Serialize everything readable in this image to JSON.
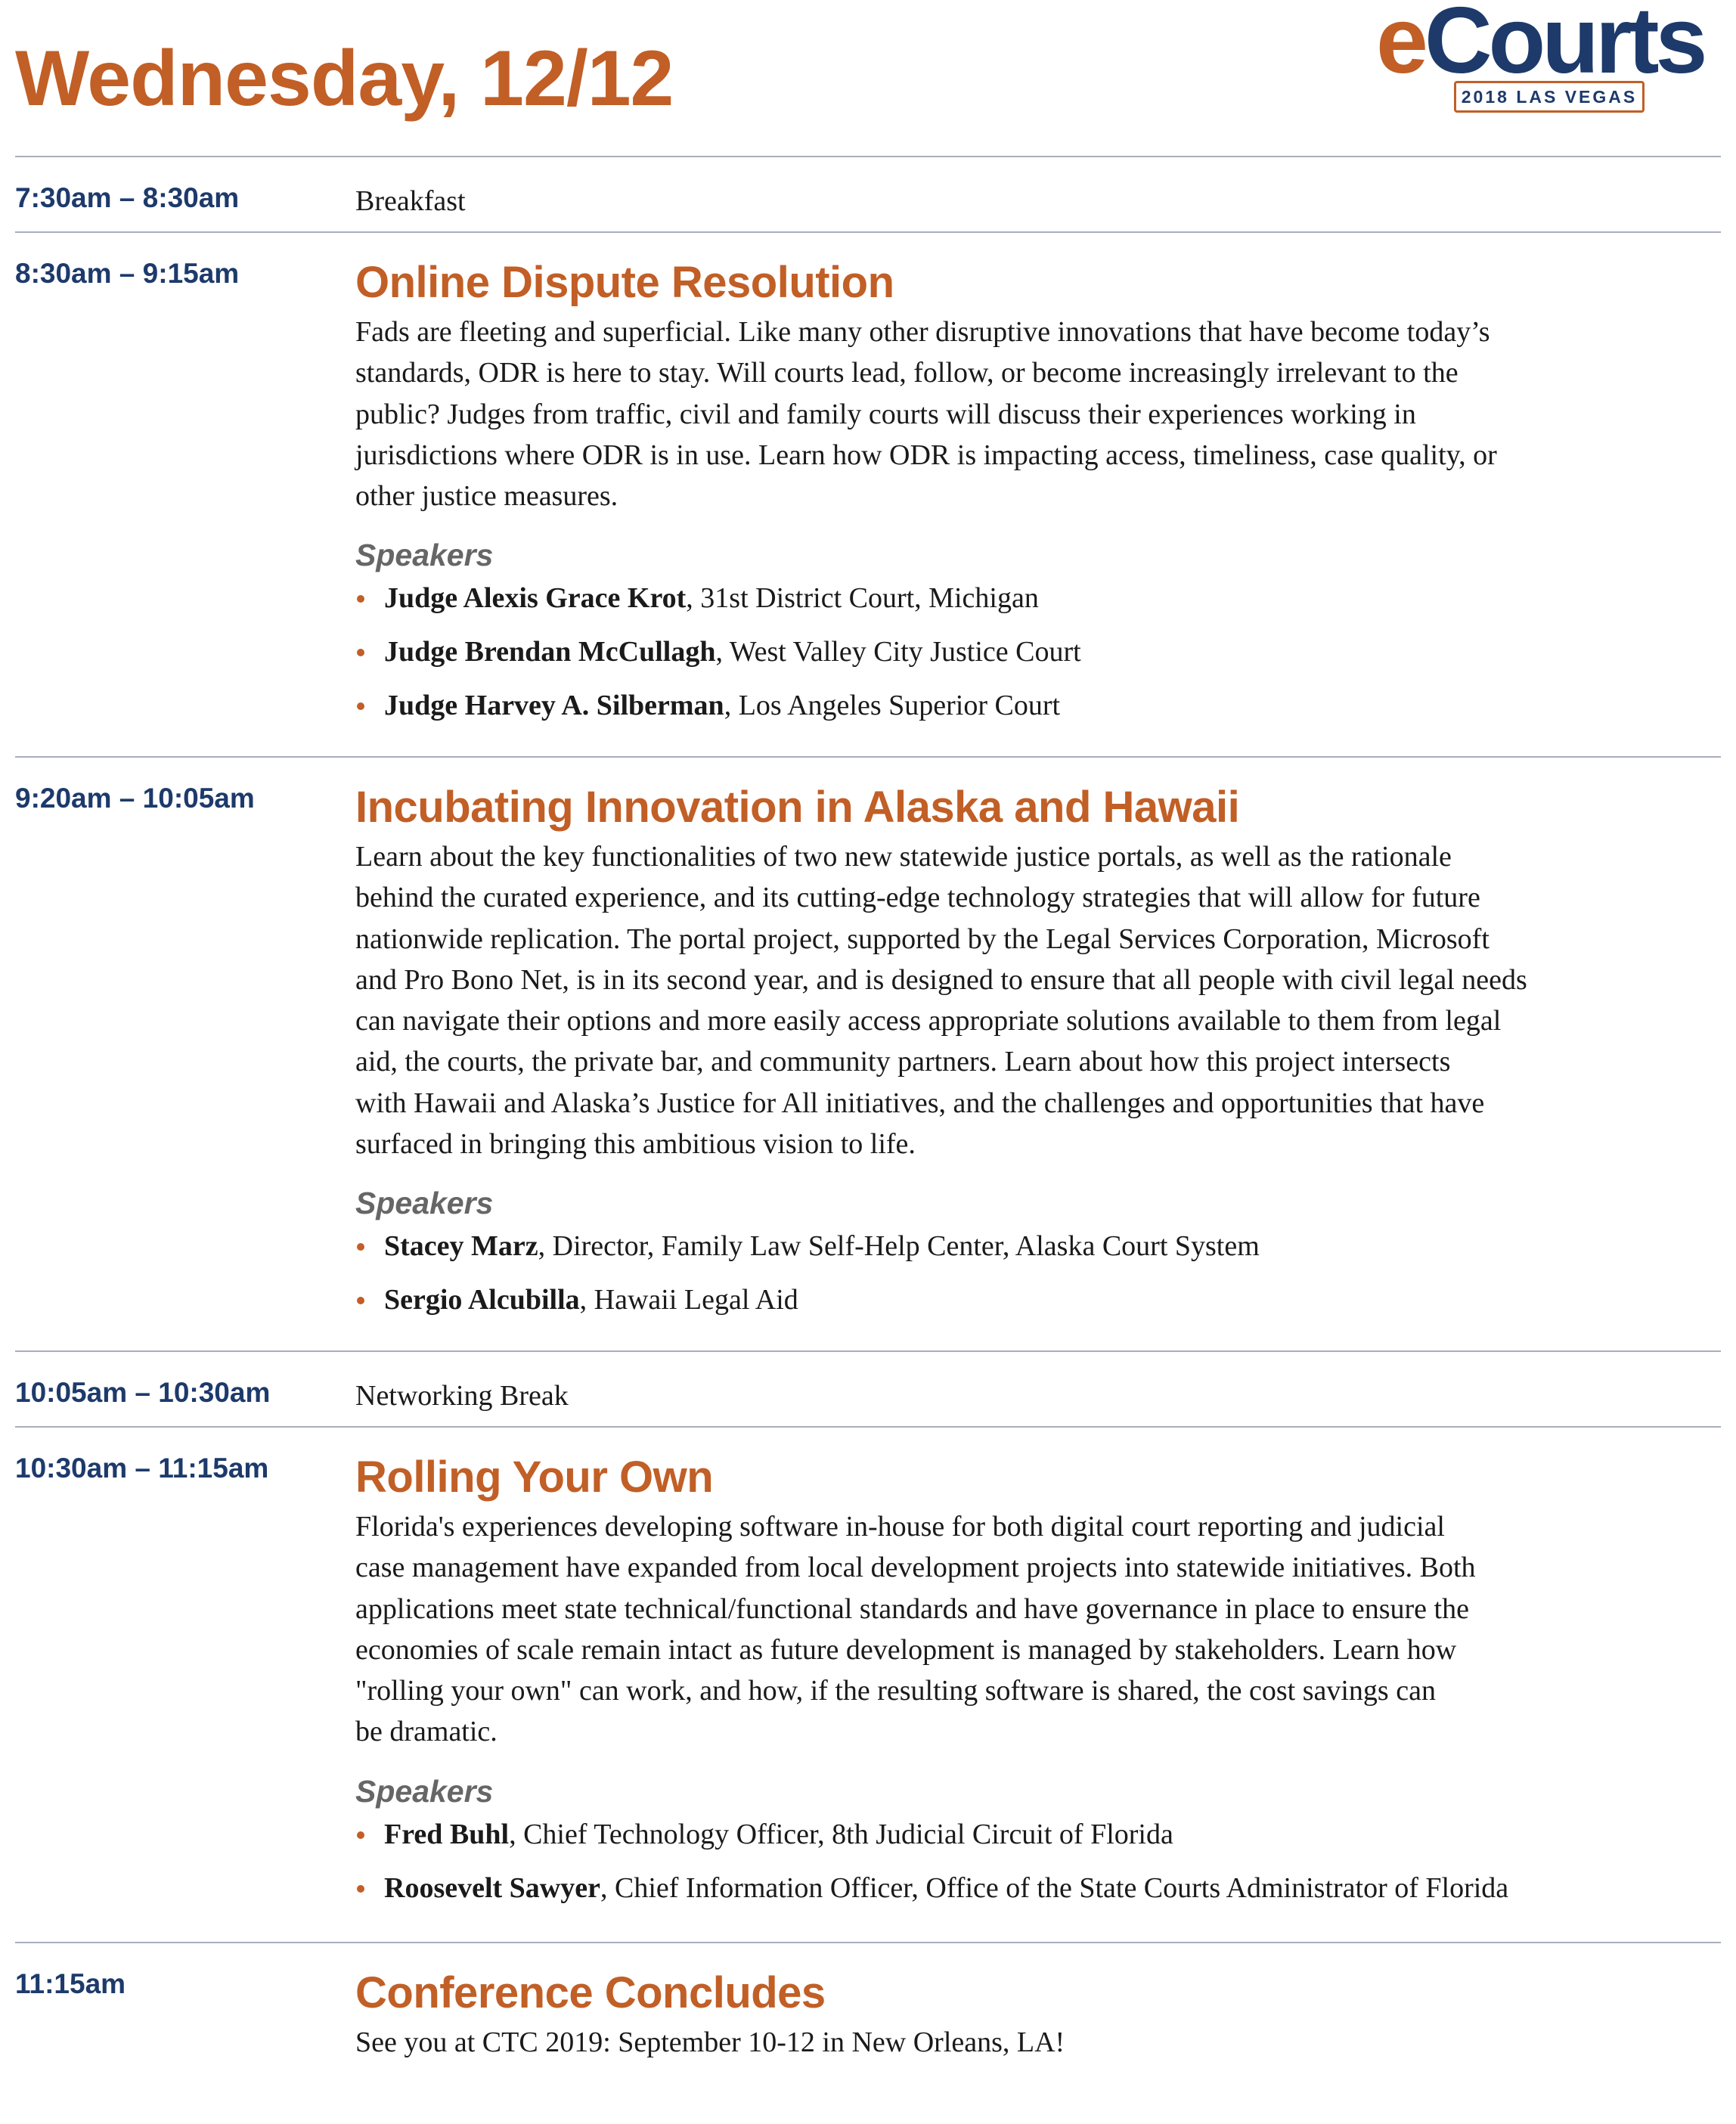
{
  "header": {
    "title": "Wednesday, 12/12",
    "logo": {
      "e": "e",
      "rest": "Courts",
      "subtitle": "2018 LAS VEGAS"
    }
  },
  "colors": {
    "accent": "#c15f26",
    "navy": "#1d3a6b",
    "rule": "#a9aebd",
    "speakers_label": "#666666"
  },
  "agenda": [
    {
      "time": "7:30am – 8:30am",
      "plain": "Breakfast"
    },
    {
      "time": "8:30am – 9:15am",
      "title": "Online Dispute Resolution",
      "description": [
        "Fads are fleeting and superficial. Like many other disruptive innovations that have become today’s",
        "standards, ODR is here to stay. Will courts lead, follow, or become increasingly irrelevant to the",
        "public? Judges from traffic, civil and family courts will discuss their experiences working in",
        "jurisdictions where ODR is in use. Learn how ODR is impacting access, timeliness, case quality, or",
        "other justice measures."
      ],
      "speakers_label": "Speakers",
      "speakers": [
        {
          "name": "Judge Alexis Grace Krot",
          "affiliation": ", 31st District Court, Michigan"
        },
        {
          "name": "Judge Brendan McCullagh",
          "affiliation": ", West Valley City Justice Court"
        },
        {
          "name": "Judge Harvey A. Silberman",
          "affiliation": ", Los Angeles Superior Court"
        }
      ]
    },
    {
      "time": "9:20am – 10:05am",
      "title": "Incubating Innovation in Alaska and Hawaii",
      "description": [
        "Learn about the key functionalities of two new statewide justice portals, as well as the rationale",
        "behind the curated experience, and its cutting-edge technology strategies that will allow for future",
        "nationwide replication. The portal project, supported by the Legal Services Corporation, Microsoft",
        "and Pro Bono Net, is in its second year, and is designed to ensure that all people with civil legal needs",
        "can navigate their options and more easily access appropriate solutions available to them from legal",
        "aid, the courts, the private bar, and community partners. Learn about how this project intersects",
        "with Hawaii and Alaska’s Justice for All initiatives, and the challenges and opportunities that have",
        "surfaced in bringing this ambitious vision to life."
      ],
      "speakers_label": "Speakers",
      "speakers": [
        {
          "name": "Stacey Marz",
          "affiliation": ", Director, Family Law Self-Help Center, Alaska Court System"
        },
        {
          "name": "Sergio Alcubilla",
          "affiliation": ", Hawaii Legal Aid"
        }
      ]
    },
    {
      "time": "10:05am – 10:30am",
      "plain": "Networking Break"
    },
    {
      "time": "10:30am – 11:15am",
      "title": "Rolling Your Own",
      "description": [
        "Florida's experiences developing software in-house for both digital court reporting and judicial",
        "case management have expanded from local development projects into statewide initiatives. Both",
        "applications meet state technical/functional standards and have governance in place to ensure the",
        "economies of scale remain intact as future development is managed by stakeholders. Learn how",
        "\"rolling your own\" can work, and how, if the resulting software is shared, the cost savings can",
        "be dramatic."
      ],
      "speakers_label": "Speakers",
      "speakers": [
        {
          "name": "Fred Buhl",
          "affiliation": ", Chief Technology Officer, 8th Judicial Circuit of Florida"
        },
        {
          "name": "Roosevelt Sawyer",
          "affiliation": ", Chief Information Officer, Office of the State Courts Administrator of Florida"
        }
      ]
    },
    {
      "time": "11:15am",
      "title": "Conference Concludes",
      "description": [
        "See you at CTC 2019: September 10-12 in New Orleans, LA!"
      ]
    }
  ]
}
